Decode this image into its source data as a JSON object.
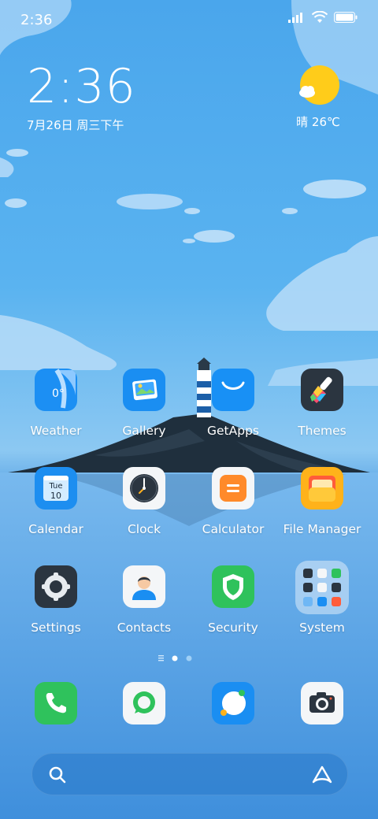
{
  "status_bar": {
    "time": "2:36"
  },
  "clock_widget": {
    "time": "2:36",
    "date": "7月26日 周三下午"
  },
  "weather_widget": {
    "summary": "晴 26℃"
  },
  "apps": [
    {
      "label": "Weather",
      "icon": "weather-icon",
      "glyph": "0°"
    },
    {
      "label": "Gallery",
      "icon": "gallery-icon"
    },
    {
      "label": "GetApps",
      "icon": "getapps-icon"
    },
    {
      "label": "Themes",
      "icon": "themes-icon"
    },
    {
      "label": "Calendar",
      "icon": "calendar-icon",
      "weekday": "Tue",
      "day": "10"
    },
    {
      "label": "Clock",
      "icon": "clock-icon"
    },
    {
      "label": "Calculator",
      "icon": "calculator-icon"
    },
    {
      "label": "File Manager",
      "icon": "file-manager-icon"
    },
    {
      "label": "Settings",
      "icon": "settings-icon"
    },
    {
      "label": "Contacts",
      "icon": "contacts-icon"
    },
    {
      "label": "Security",
      "icon": "security-icon"
    },
    {
      "label": "System",
      "icon": "system-folder-icon"
    }
  ],
  "dock": [
    {
      "icon": "phone-icon"
    },
    {
      "icon": "messages-icon"
    },
    {
      "icon": "browser-icon"
    },
    {
      "icon": "camera-icon"
    }
  ],
  "page_indicator": {
    "pages": 2,
    "current": 1
  }
}
